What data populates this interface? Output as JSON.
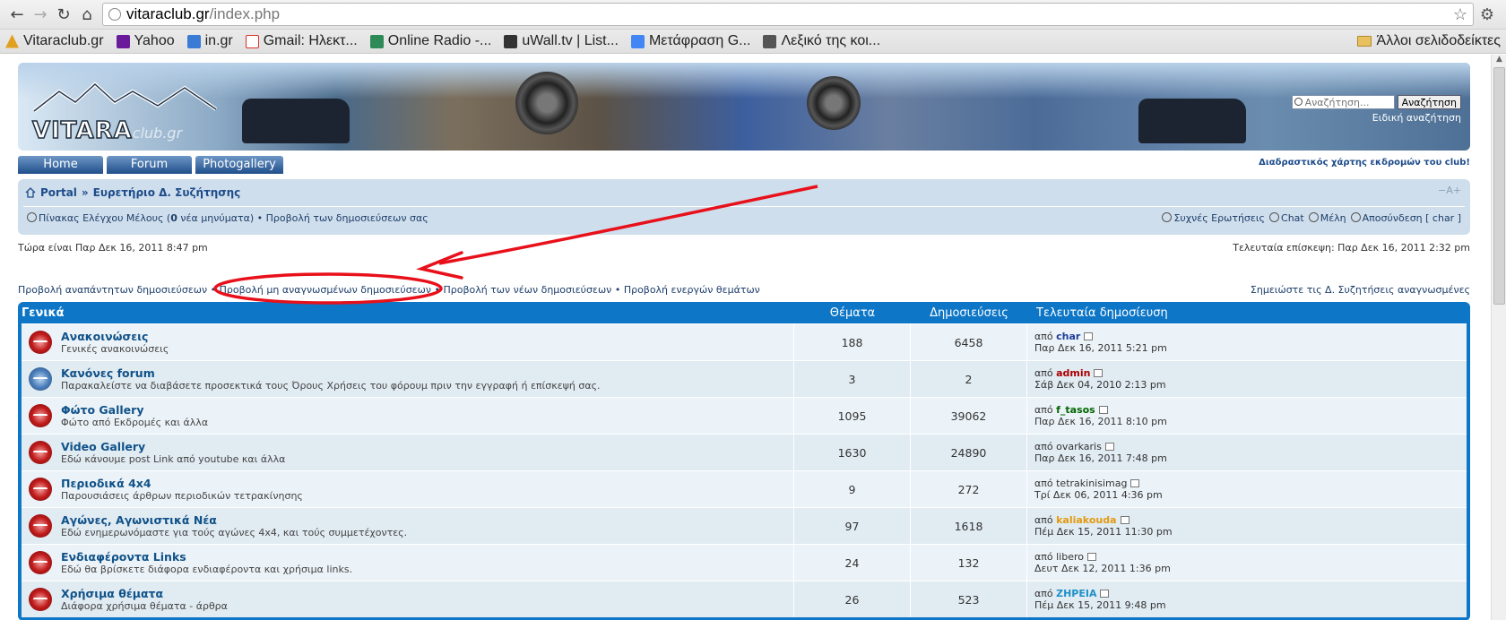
{
  "browser": {
    "url_host": "vitaraclub.gr",
    "url_path": "/index.php",
    "bookmarks": [
      {
        "label": "Vitaraclub.gr",
        "color": "#e0a020"
      },
      {
        "label": "Yahoo",
        "color": "#6a1b9a"
      },
      {
        "label": "in.gr",
        "color": "#3a7bd5"
      },
      {
        "label": "Gmail: Ηλεκτ...",
        "color": "#d93025"
      },
      {
        "label": "Online Radio -...",
        "color": "#2e8b57"
      },
      {
        "label": "uWall.tv | List...",
        "color": "#333333"
      },
      {
        "label": "Μετάφραση G...",
        "color": "#4285f4"
      },
      {
        "label": "Λεξικό της κοι...",
        "color": "#555555"
      }
    ],
    "other_bookmarks": "Άλλοι σελιδοδείκτες"
  },
  "header": {
    "logo_main": "VITARA",
    "logo_suffix": "club.gr",
    "search_placeholder": "Αναζήτηση...",
    "search_button": "Αναζήτηση",
    "advanced_search": "Ειδική αναζήτηση",
    "map_link": "Διαδραστικός χάρτης εκδρομών του club!"
  },
  "tabs": [
    "Home",
    "Forum",
    "Photogallery"
  ],
  "navbar": {
    "breadcrumb_portal": "Portal",
    "breadcrumb_sep": "»",
    "breadcrumb_index": "Ευρετήριο Δ. Συζήτησης",
    "font_size_toggle": "−A+",
    "ucp_text_pre": "Πίνακας Ελέγχου Μέλους (",
    "ucp_count": "0",
    "ucp_text_post": " νέα μηνύματα)",
    "bullet": "•",
    "view_own_posts": "Προβολή των δημοσιεύσεων σας",
    "faq": "Συχνές Ερωτήσεις",
    "chat": "Chat",
    "members": "Μέλη",
    "logout": "Αποσύνδεση [ char ]"
  },
  "time": {
    "now": "Τώρα είναι Παρ Δεκ 16, 2011 8:47 pm",
    "last_visit": "Τελευταία επίσκεψη: Παρ Δεκ 16, 2011 2:32 pm"
  },
  "search_links": {
    "unanswered": "Προβολή αναπάντητων δημοσιεύσεων",
    "unread": "Προβολή μη αναγνωσμένων δημοσιεύσεων",
    "new_posts": "Προβολή των νέων δημοσιεύσεων",
    "active": "Προβολή ενεργών θεμάτων",
    "mark_read": "Σημειώστε τις Δ. Συζητήσεις αναγνωσμένες",
    "bullet": "•"
  },
  "forum_table": {
    "category": "Γενικά",
    "col_topics": "Θέματα",
    "col_posts": "Δημοσιεύσεις",
    "col_last": "Τελευταία δημοσίευση",
    "by": "από",
    "rows": [
      {
        "title": "Ανακοινώσεις",
        "desc": "Γενικές ανακοινώσεις",
        "topics": "188",
        "posts": "6458",
        "user": "char",
        "user_color": "#1d3e9a",
        "date": "Παρ Δεκ 16, 2011 5:21 pm",
        "icon": "red"
      },
      {
        "title": "Κανόνες forum",
        "desc": "Παρακαλείστε να διαβάσετε προσεκτικά τους Όρους Χρήσεις του φόρουμ πριν την εγγραφή ή επίσκεψή σας.",
        "topics": "3",
        "posts": "2",
        "user": "admin",
        "user_color": "#aa0000",
        "date": "Σάβ Δεκ 04, 2010 2:13 pm",
        "icon": "blue"
      },
      {
        "title": "Φώτο Gallery",
        "desc": "Φώτο από Εκδρομές και άλλα",
        "topics": "1095",
        "posts": "39062",
        "user": "f_tasos",
        "user_color": "#006600",
        "date": "Παρ Δεκ 16, 2011 8:10 pm",
        "icon": "red"
      },
      {
        "title": "Video Gallery",
        "desc": "Εδώ κάνουμε post Link από youtube και άλλα",
        "topics": "1630",
        "posts": "24890",
        "user": "ovarkaris",
        "user_color": "#333333",
        "date": "Παρ Δεκ 16, 2011 7:48 pm",
        "icon": "red"
      },
      {
        "title": "Περιοδικά 4x4",
        "desc": "Παρουσιάσεις άρθρων περιοδικών τετρακίνησης",
        "topics": "9",
        "posts": "272",
        "user": "tetrakinisimag",
        "user_color": "#333333",
        "date": "Τρί Δεκ 06, 2011 4:36 pm",
        "icon": "red"
      },
      {
        "title": "Αγώνες, Αγωνιστικά Νέα",
        "desc": "Εδώ ενημερωνόμαστε για τούς αγώνες 4x4, και τούς συμμετέχοντες.",
        "topics": "97",
        "posts": "1618",
        "user": "kaliakouda",
        "user_color": "#e39a10",
        "date": "Πέμ Δεκ 15, 2011 11:30 pm",
        "icon": "red"
      },
      {
        "title": "Ενδιαφέροντα Links",
        "desc": "Εδώ θα βρίσκετε διάφορα ενδιαφέροντα και χρήσιμα links.",
        "topics": "24",
        "posts": "132",
        "user": "libero",
        "user_color": "#333333",
        "date": "Δευτ Δεκ 12, 2011 1:36 pm",
        "icon": "red"
      },
      {
        "title": "Χρήσιμα θέματα",
        "desc": "Διάφορα χρήσιμα θέματα - άρθρα",
        "topics": "26",
        "posts": "523",
        "user": "ΖΗΡΕΙΑ",
        "user_color": "#1e90c8",
        "date": "Πέμ Δεκ 15, 2011 9:48 pm",
        "icon": "red"
      }
    ]
  },
  "colors": {
    "accent": "#0d76c6",
    "annotation": "#e8101a",
    "link": "#105289"
  }
}
